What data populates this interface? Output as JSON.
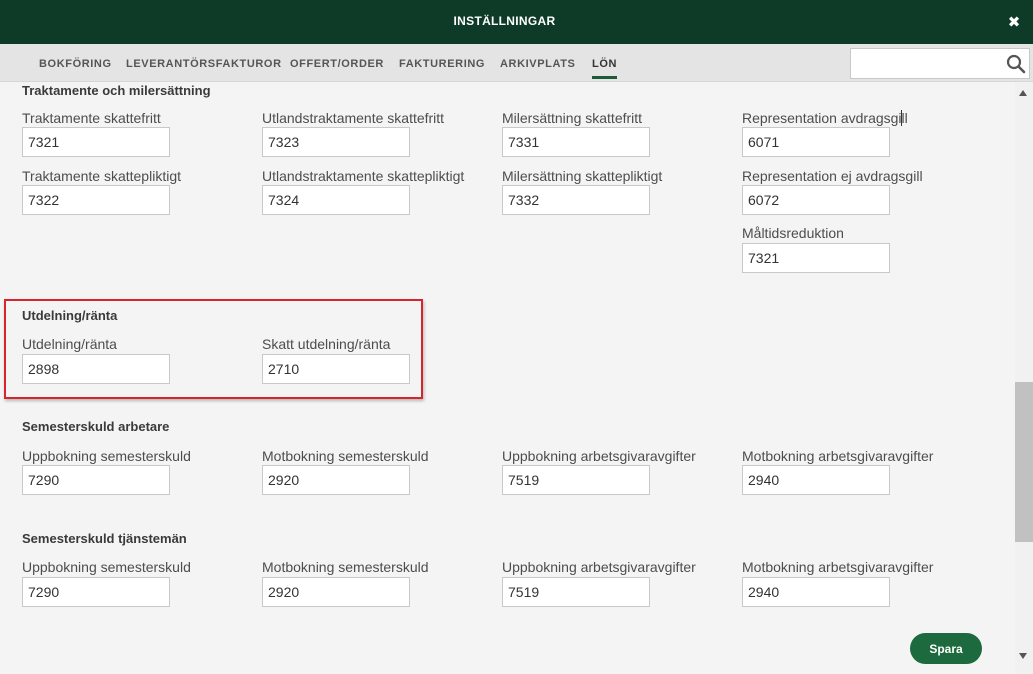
{
  "header": {
    "title": "INSTÄLLNINGAR",
    "close_symbol": "✖"
  },
  "tabs": [
    {
      "label": "BOKFÖRING",
      "active": false
    },
    {
      "label": "LEVERANTÖRSFAKTUROR",
      "active": false
    },
    {
      "label": "OFFERT/ORDER",
      "active": false
    },
    {
      "label": "FAKTURERING",
      "active": false
    },
    {
      "label": "ARKIVPLATS",
      "active": false
    },
    {
      "label": "LÖN",
      "active": true
    }
  ],
  "search": {
    "value": "",
    "placeholder": ""
  },
  "sections": {
    "traktamente": {
      "title": "Traktamente och milersättning",
      "fields": [
        {
          "label": "Traktamente skattefritt",
          "value": "7321"
        },
        {
          "label": "Utlandstraktamente skattefritt",
          "value": "7323"
        },
        {
          "label": "Milersättning skattefritt",
          "value": "7331"
        },
        {
          "label": "Representation avdragsgill",
          "value": "6071"
        },
        {
          "label": "Traktamente skattepliktigt",
          "value": "7322"
        },
        {
          "label": "Utlandstraktamente skattepliktigt",
          "value": "7324"
        },
        {
          "label": "Milersättning skattepliktigt",
          "value": "7332"
        },
        {
          "label": "Representation ej avdragsgill",
          "value": "6072"
        },
        {
          "label": "Måltidsreduktion",
          "value": "7321"
        }
      ]
    },
    "utdelning": {
      "title": "Utdelning/ränta",
      "fields": [
        {
          "label": "Utdelning/ränta",
          "value": "2898"
        },
        {
          "label": "Skatt utdelning/ränta",
          "value": "2710"
        }
      ]
    },
    "semester_arbetare": {
      "title": "Semesterskuld arbetare",
      "fields": [
        {
          "label": "Uppbokning semesterskuld",
          "value": "7290"
        },
        {
          "label": "Motbokning semesterskuld",
          "value": "2920"
        },
        {
          "label": "Uppbokning arbetsgivaravgifter",
          "value": "7519"
        },
        {
          "label": "Motbokning arbetsgivaravgifter",
          "value": "2940"
        }
      ]
    },
    "semester_tjansteman": {
      "title": "Semesterskuld tjänstemän",
      "fields": [
        {
          "label": "Uppbokning semesterskuld",
          "value": "7290"
        },
        {
          "label": "Motbokning semesterskuld",
          "value": "2920"
        },
        {
          "label": "Uppbokning arbetsgivaravgifter",
          "value": "7519"
        },
        {
          "label": "Motbokning arbetsgivaravgifter",
          "value": "2940"
        }
      ]
    }
  },
  "save_button": {
    "label": "Spara",
    "color": "#1c6a3d"
  },
  "colors": {
    "header_bg": "#0d3b27",
    "highlight": "#d7262b"
  }
}
